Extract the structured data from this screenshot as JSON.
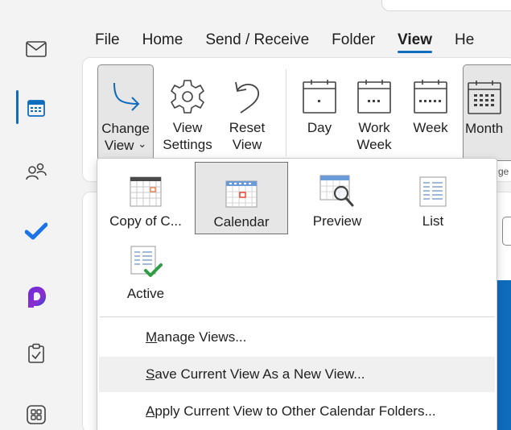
{
  "tabs": [
    {
      "label": "File"
    },
    {
      "label": "Home"
    },
    {
      "label": "Send / Receive"
    },
    {
      "label": "Folder"
    },
    {
      "label": "View",
      "active": true
    },
    {
      "label": "He"
    }
  ],
  "ribbon": {
    "change_view": {
      "line1": "Change",
      "line2": "View",
      "chevron": "⌄"
    },
    "view_settings": {
      "line1": "View",
      "line2": "Settings"
    },
    "reset_view": {
      "line1": "Reset",
      "line2": "View"
    },
    "day": {
      "line1": "Day"
    },
    "work_week": {
      "line1": "Work",
      "line2": "Week"
    },
    "week": {
      "line1": "Week"
    },
    "month": {
      "line1": "Month"
    },
    "group_label_partial": "ge"
  },
  "dropdown": {
    "views": [
      {
        "label": "Copy of C...",
        "icon": "calendar-grid-icon"
      },
      {
        "label": "Calendar",
        "icon": "calendar-icon",
        "selected": true
      },
      {
        "label": "Preview",
        "icon": "calendar-preview-icon"
      },
      {
        "label": "List",
        "icon": "list-icon"
      },
      {
        "label": "Active",
        "icon": "active-list-icon"
      }
    ],
    "menu": [
      {
        "mnemonic": "M",
        "rest": "anage Views..."
      },
      {
        "mnemonic": "S",
        "rest": "ave Current View As a New View..."
      },
      {
        "mnemonic": "A",
        "rest": "pply Current View to Other Calendar Folders..."
      }
    ]
  },
  "colors": {
    "accent": "#0f6cbd",
    "todo": "#1a73e8",
    "check": "#2e9e44"
  }
}
